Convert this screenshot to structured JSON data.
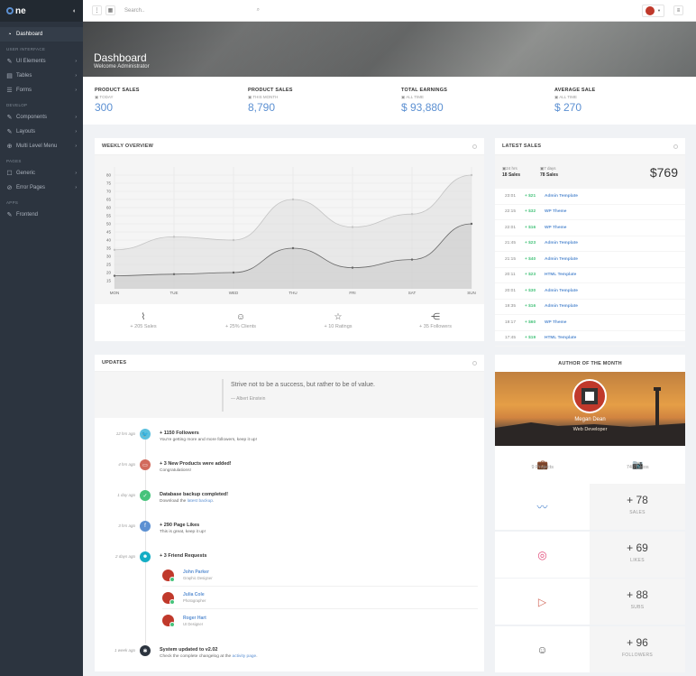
{
  "brand": {
    "name": "ne"
  },
  "sidebar": {
    "items": [
      {
        "label": "Dashboard",
        "icon": "dashboard-icon"
      },
      {
        "header": "USER INTERFACE"
      },
      {
        "label": "UI Elements",
        "icon": "ui-elements-icon"
      },
      {
        "label": "Tables",
        "icon": "tables-icon"
      },
      {
        "label": "Forms",
        "icon": "forms-icon"
      },
      {
        "header": "DEVELOP"
      },
      {
        "label": "Components",
        "icon": "components-icon"
      },
      {
        "label": "Layouts",
        "icon": "layouts-icon"
      },
      {
        "label": "Multi Level Menu",
        "icon": "multi-level-icon"
      },
      {
        "header": "PAGES"
      },
      {
        "label": "Generic",
        "icon": "generic-icon"
      },
      {
        "label": "Error Pages",
        "icon": "error-pages-icon"
      },
      {
        "header": "APPS"
      },
      {
        "label": "Frontend",
        "icon": "frontend-icon"
      }
    ]
  },
  "topbar": {
    "search_placeholder": "Search.."
  },
  "hero": {
    "title": "Dashboard",
    "subtitle": "Welcome Administrator"
  },
  "stats": [
    {
      "label": "PRODUCT SALES",
      "period": "TODAY",
      "value": "300"
    },
    {
      "label": "PRODUCT SALES",
      "period": "THIS MONTH",
      "value": "8,790"
    },
    {
      "label": "TOTAL EARNINGS",
      "period": "ALL TIME",
      "value": "$ 93,880"
    },
    {
      "label": "AVERAGE SALE",
      "period": "ALL TIME",
      "value": "$ 270"
    }
  ],
  "weekly": {
    "title": "WEEKLY OVERVIEW",
    "stats": [
      {
        "label": "+ 205 Sales",
        "icon": "trend-icon"
      },
      {
        "label": "+ 25% Clients",
        "icon": "user-icon"
      },
      {
        "label": "+ 10 Ratings",
        "icon": "star-icon"
      },
      {
        "label": "+ 35 Followers",
        "icon": "share-icon"
      }
    ]
  },
  "chart_data": {
    "type": "line",
    "categories": [
      "MON",
      "TUE",
      "WED",
      "THU",
      "FRI",
      "SAT",
      "SUN"
    ],
    "series": [
      {
        "values": [
          34,
          42,
          40,
          65,
          48,
          56,
          80
        ]
      },
      {
        "values": [
          18,
          19,
          20,
          35,
          23,
          28,
          50
        ]
      }
    ],
    "yticks": [
      15,
      20,
      25,
      30,
      35,
      40,
      45,
      50,
      55,
      60,
      65,
      70,
      75,
      80
    ],
    "ylim": [
      10,
      85
    ]
  },
  "latest": {
    "title": "LATEST SALES",
    "c1_label": "24 hrs",
    "c1_value": "18 Sales",
    "c2_label": "7 days",
    "c2_value": "78 Sales",
    "total": "$769",
    "rows": [
      {
        "time": "23:01",
        "amount": "+ $21",
        "name": "Admin Template"
      },
      {
        "time": "22:15",
        "amount": "+ $32",
        "name": "WP Theme"
      },
      {
        "time": "22:01",
        "amount": "+ $16",
        "name": "WP Theme"
      },
      {
        "time": "21:45",
        "amount": "+ $23",
        "name": "Admin Template"
      },
      {
        "time": "21:15",
        "amount": "+ $40",
        "name": "Admin Template"
      },
      {
        "time": "20:11",
        "amount": "+ $23",
        "name": "HTML Template"
      },
      {
        "time": "20:01",
        "amount": "+ $30",
        "name": "Admin Template"
      },
      {
        "time": "19:35",
        "amount": "+ $16",
        "name": "Admin Template"
      },
      {
        "time": "19:17",
        "amount": "+ $60",
        "name": "WP Theme"
      },
      {
        "time": "17:45",
        "amount": "+ $19",
        "name": "HTML Template"
      }
    ]
  },
  "updates": {
    "title": "UPDATES",
    "quote": "Strive not to be a success, but rather to be of value.",
    "quote_author": "— Albert Einstein",
    "items": [
      {
        "time": "12 hrs ago",
        "title": "+ 1150 Followers",
        "sub": "You're getting more and more followers, keep it up!",
        "color": "#5bc0de",
        "icon": "twitter-icon"
      },
      {
        "time": "4 hrs ago",
        "title": "+ 3 New Products were added!",
        "sub": "Congratulations!",
        "color": "#d26a5c",
        "icon": "products-icon"
      },
      {
        "time": "1 day ago",
        "title": "Database backup completed!",
        "sub": "Download the",
        "link": "latest backup",
        "sub_end": ".",
        "color": "#46c37b",
        "icon": "check-icon"
      },
      {
        "time": "3 hrs ago",
        "title": "+ 290 Page Likes",
        "sub": "This is great, keep it up!",
        "color": "#5c90d2",
        "icon": "facebook-icon"
      },
      {
        "time": "2 days ago",
        "title": "+ 3 Friend Requests",
        "color": "#14adc4",
        "icon": "users-icon"
      },
      {
        "time": "1 week ago",
        "title": "System updated to v2.02",
        "sub": "Check the complete changelog at the",
        "link": "activity page",
        "sub_end": ".",
        "color": "#2c343f",
        "icon": "cog-icon"
      }
    ],
    "friends": [
      {
        "name": "John Parker",
        "role": "Graphic Designer"
      },
      {
        "name": "Julia Cole",
        "role": "Photographer"
      },
      {
        "name": "Roger Hart",
        "role": "UI Designer"
      }
    ]
  },
  "author": {
    "title": "AUTHOR OF THE MONTH",
    "name": "Megan Dean",
    "role": "Web Developer",
    "projects": "9 Projects",
    "photos": "74 Photos"
  },
  "minis": [
    {
      "value": "78",
      "label": "SALES",
      "icon": "trend-icon",
      "color": "#5c90d2"
    },
    {
      "value": "69",
      "label": "LIKES",
      "icon": "dribbble-icon",
      "color": "#e24c7a"
    },
    {
      "value": "88",
      "label": "SUBS",
      "icon": "youtube-icon",
      "color": "#d26a5c"
    },
    {
      "value": "96",
      "label": "FOLLOWERS",
      "icon": "user-icon",
      "color": "#555555"
    }
  ]
}
